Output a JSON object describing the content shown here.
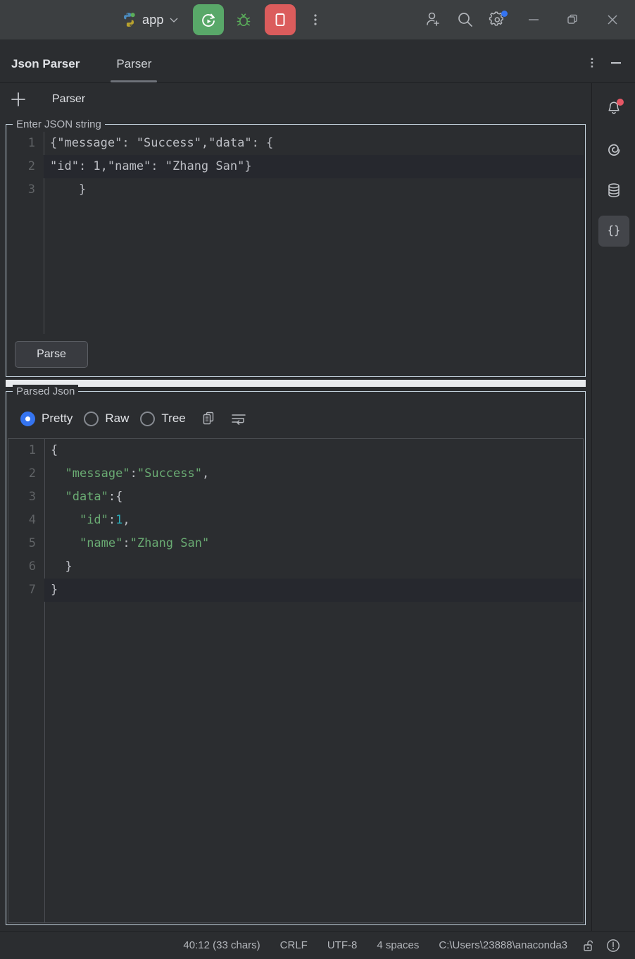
{
  "titlebar": {
    "run_config_name": "app",
    "python_logo_icon": "python-logo-icon",
    "chevron_icon": "chevron-down-icon",
    "run_icon": "run-rerun-icon",
    "debug_icon": "debug-bug-icon",
    "stop_icon": "stop-square-icon",
    "more_icon": "more-vertical-icon",
    "add_user_icon": "add-user-icon",
    "search_icon": "search-icon",
    "settings_icon": "settings-gear-icon",
    "minimize_icon": "window-minimize-icon",
    "restore_icon": "window-restore-icon",
    "close_icon": "window-close-icon"
  },
  "toolwindow": {
    "title": "Json Parser",
    "tab_label": "Parser",
    "options_icon": "more-vertical-icon",
    "hide_icon": "window-minimize-icon"
  },
  "subbar": {
    "add_icon": "plus-icon",
    "tab_label": "Parser"
  },
  "right_stripe": {
    "items": [
      {
        "icon": "notifications-bell-icon",
        "active": false,
        "badge": true
      },
      {
        "icon": "anaconda-spiral-icon",
        "active": false,
        "badge": false
      },
      {
        "icon": "database-icon",
        "active": false,
        "badge": false
      },
      {
        "icon": "json-braces-icon",
        "active": true,
        "badge": false
      }
    ]
  },
  "input_panel": {
    "legend": "Enter JSON string",
    "line_numbers": [
      "1",
      "2",
      "3"
    ],
    "lines": [
      "{\"message\": \"Success\",\"data\": {",
      "\"id\": 1,\"name\": \"Zhang San\"}",
      "    }"
    ],
    "highlighted_line_index": 1,
    "parse_button_label": "Parse"
  },
  "output_panel": {
    "legend": "Parsed Json",
    "view_modes": [
      {
        "label": "Pretty",
        "selected": true
      },
      {
        "label": "Raw",
        "selected": false
      },
      {
        "label": "Tree",
        "selected": false
      }
    ],
    "copy_icon": "copy-icon",
    "wrap_icon": "soft-wrap-icon",
    "line_numbers": [
      "1",
      "2",
      "3",
      "4",
      "5",
      "6",
      "7"
    ],
    "highlighted_line_index": 6,
    "lines": [
      [
        {
          "t": "{",
          "c": "punct"
        }
      ],
      [
        {
          "t": "  ",
          "c": "punct"
        },
        {
          "t": "\"message\"",
          "c": "str"
        },
        {
          "t": ":",
          "c": "punct"
        },
        {
          "t": "\"Success\"",
          "c": "str"
        },
        {
          "t": ",",
          "c": "punct"
        }
      ],
      [
        {
          "t": "  ",
          "c": "punct"
        },
        {
          "t": "\"data\"",
          "c": "str"
        },
        {
          "t": ":{",
          "c": "punct"
        }
      ],
      [
        {
          "t": "    ",
          "c": "punct"
        },
        {
          "t": "\"id\"",
          "c": "str"
        },
        {
          "t": ":",
          "c": "punct"
        },
        {
          "t": "1",
          "c": "num"
        },
        {
          "t": ",",
          "c": "punct"
        }
      ],
      [
        {
          "t": "    ",
          "c": "punct"
        },
        {
          "t": "\"name\"",
          "c": "str"
        },
        {
          "t": ":",
          "c": "punct"
        },
        {
          "t": "\"Zhang San\"",
          "c": "str"
        }
      ],
      [
        {
          "t": "  }",
          "c": "punct"
        }
      ],
      [
        {
          "t": "}",
          "c": "punct"
        }
      ]
    ]
  },
  "statusbar": {
    "caret_position": "40:12 (33 chars)",
    "line_separator": "CRLF",
    "encoding": "UTF-8",
    "indent": "4 spaces",
    "interpreter": "C:\\Users\\23888\\anaconda3",
    "lock_icon": "unlocked-padlock-icon",
    "problems_icon": "warning-circle-icon"
  },
  "colors": {
    "accent_blue": "#3574f0",
    "run_green": "#59a869",
    "stop_red": "#db5c5c",
    "string_green": "#6aab73",
    "number_cyan": "#2aacb8",
    "groupbox_border": "#c6d4df",
    "notification_red": "#e55765"
  }
}
